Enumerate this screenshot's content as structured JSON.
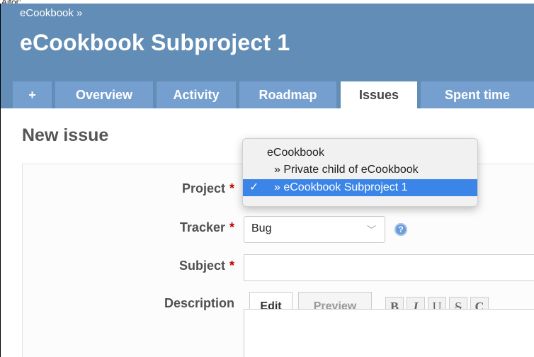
{
  "caption": "Aitor:",
  "header": {
    "root_link": "eCookbook »",
    "project_title": "eCookbook Subproject 1"
  },
  "tabs": [
    {
      "label": "+"
    },
    {
      "label": "Overview"
    },
    {
      "label": "Activity"
    },
    {
      "label": "Roadmap"
    },
    {
      "label": "Issues",
      "selected": true
    },
    {
      "label": "Spent time"
    }
  ],
  "page_heading": "New issue",
  "form": {
    "project_label": "Project",
    "tracker_label": "Tracker",
    "tracker_value": "Bug",
    "subject_label": "Subject",
    "subject_value": "",
    "description_label": "Description",
    "required_marker": "*",
    "help_icon_glyph": "?"
  },
  "editor": {
    "edit_tab": "Edit",
    "preview_tab": "Preview",
    "toolbar": [
      "B",
      "I",
      "U",
      "S",
      "C"
    ]
  },
  "project_dropdown": {
    "options": [
      {
        "label": "eCookbook",
        "selected": false
      },
      {
        "label": "» Private child of eCookbook",
        "selected": false
      },
      {
        "label": "» eCookbook Subproject 1",
        "selected": true
      }
    ],
    "check_glyph": "✓"
  },
  "colors": {
    "header": "#628db6",
    "tab_bg": "#759fcf",
    "required": "#bb0000",
    "selection": "#3b85e8"
  }
}
